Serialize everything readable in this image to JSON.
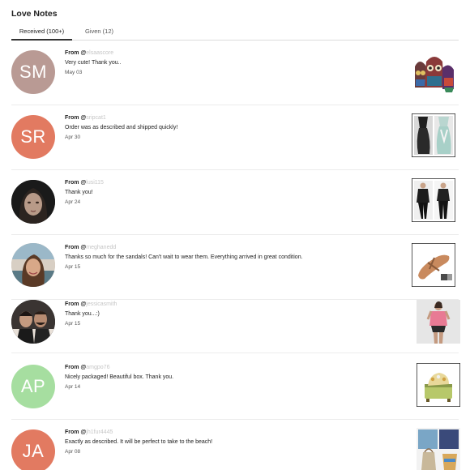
{
  "page": {
    "title": "Love Notes"
  },
  "tabs": [
    {
      "label": "Received (100+)",
      "active": true
    },
    {
      "label": "Given (12)",
      "active": false
    }
  ],
  "notes": [
    {
      "from_label": "From @",
      "handle": "elsaascore",
      "message": "Very cute! Thank you..",
      "date": "May 03",
      "avatar": {
        "type": "initials",
        "initials": "SM",
        "color": "#b99a94"
      },
      "thumb": "owl-bags"
    },
    {
      "from_label": "From @",
      "handle": "sripcat1",
      "message": "Order was as described and shipped quickly!",
      "date": "Apr 30",
      "avatar": {
        "type": "initials",
        "initials": "SR",
        "color": "#e27a61"
      },
      "thumb": "tank-tops"
    },
    {
      "from_label": "From @",
      "handle": "lusi115",
      "message": "Thank you!",
      "date": "Apr 24",
      "avatar": {
        "type": "photo",
        "photo": "portrait-woman"
      },
      "thumb": "black-outfit"
    },
    {
      "from_label": "From @",
      "handle": "meghanedd",
      "message": "Thanks so much for the sandals! Can't wait to wear them. Everything arrived in great condition.",
      "date": "Apr 15",
      "avatar": {
        "type": "photo",
        "photo": "portrait-beach"
      },
      "thumb": "sandals"
    },
    {
      "from_label": "From @",
      "handle": "jessicasmith",
      "message": "Thank you...:)",
      "date": "Apr 15",
      "avatar": {
        "type": "photo",
        "photo": "couple"
      },
      "thumb": "pink-top"
    },
    {
      "from_label": "From @",
      "handle": "amgpo76",
      "message": "Nicely packaged! Beautiful box. Thank you.",
      "date": "Apr 14",
      "avatar": {
        "type": "initials",
        "initials": "AP",
        "color": "#a6dea0"
      },
      "thumb": "jewelry-box"
    },
    {
      "from_label": "From @",
      "handle": "jh1fur4445",
      "message": "Exactly as described. It will be perfect to take to the beach!",
      "date": "Apr 08",
      "avatar": {
        "type": "initials",
        "initials": "JA",
        "color": "#e27a61"
      },
      "thumb": "beach-bag"
    }
  ]
}
